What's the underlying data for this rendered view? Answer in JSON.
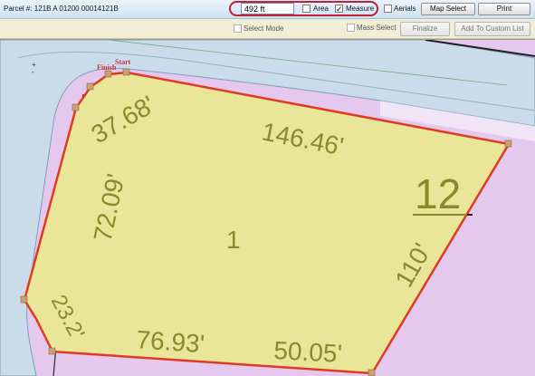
{
  "toolbar": {
    "parcel_text": "Parcel #: 121B A 01200 00014121B",
    "distance_value": "492 ft",
    "area_label": "Area",
    "measure_label": "Measure",
    "aerials_label": "Aerials",
    "map_select_label": "Map Select",
    "print_label": "Print",
    "area_checked": false,
    "measure_checked": true,
    "aerials_checked": false
  },
  "toolbar2": {
    "select_mode_label": "Select Mode",
    "mass_select_label": "Mass Select",
    "finalize_label": "Finalize",
    "add_custom_label": "Add To Custom List"
  },
  "map": {
    "zoom_in": "+",
    "zoom_out": "-",
    "finish_label": "Finish",
    "start_label": "Start",
    "lot_number": "12",
    "parcel_label": "1",
    "dimensions": [
      "37.68'",
      "146.46'",
      "72.09'",
      "110'",
      "23.2'",
      "76.93'",
      "50.05'"
    ],
    "colors": {
      "parcel_fill": "#e9e69a",
      "parcel_outline": "#e03a22",
      "road_fill": "#c9dce9",
      "lot_fill": "#e5c8ee",
      "dimension_text": "#8a8a2a",
      "measure_oval": "#c0203a"
    }
  }
}
